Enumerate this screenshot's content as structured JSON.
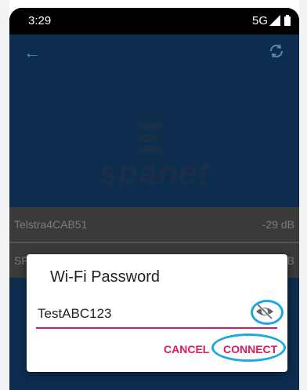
{
  "status_bar": {
    "time": "3:29",
    "network": "5G"
  },
  "header": {
    "logo_text": "spanet"
  },
  "networks": [
    {
      "name": "Telstra4CAB51",
      "signal": "-29 dB"
    },
    {
      "name": "SF",
      "signal": "dB"
    }
  ],
  "dialog": {
    "title": "Wi-Fi Password",
    "password_value": "TestABC123",
    "cancel_label": "CANCEL",
    "connect_label": "CONNECT"
  },
  "colors": {
    "accent": "#d81b60",
    "highlight": "#1ea6e5",
    "brand_bg": "#0d2d4f"
  },
  "icons": [
    "back-arrow-icon",
    "refresh-icon",
    "visibility-off-icon",
    "signal-icon",
    "battery-icon"
  ]
}
